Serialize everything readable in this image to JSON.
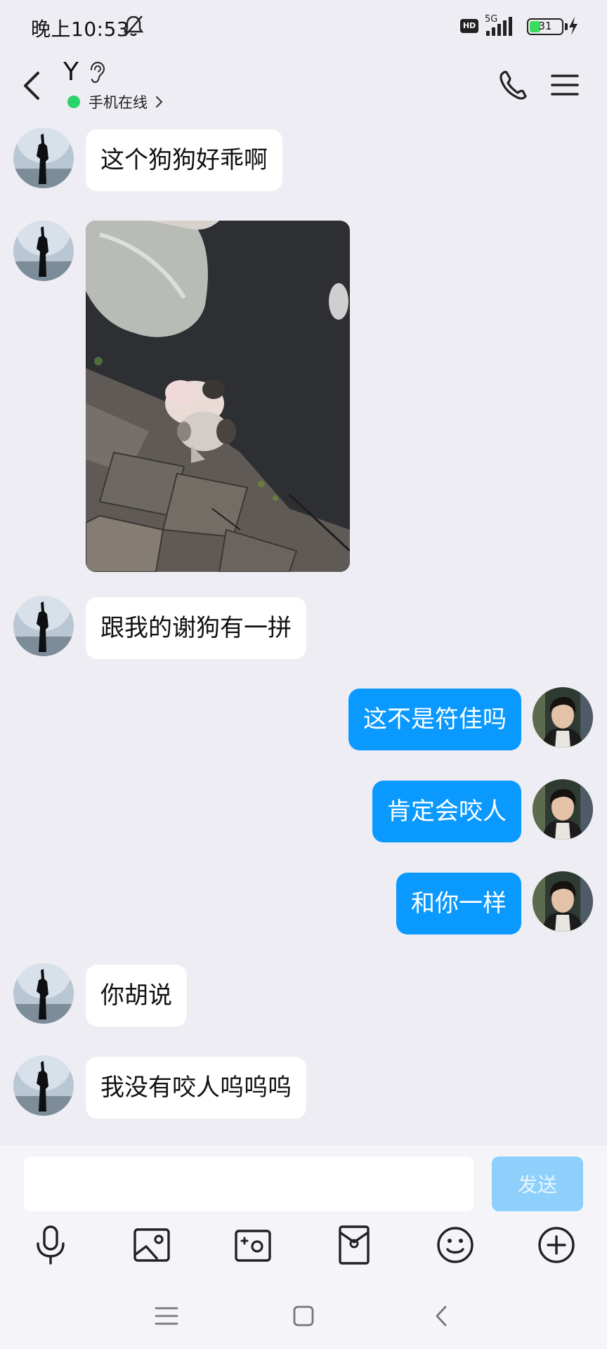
{
  "status_bar": {
    "time": "晚上10:53",
    "hd_label": "HD",
    "network_label": "5G",
    "battery_level": "31",
    "battery_fraction": 0.31
  },
  "header": {
    "contact_name": "Y",
    "online_status": "手机在线",
    "icons": [
      "back-icon",
      "ear-icon",
      "chevron-right-icon",
      "phone-icon",
      "menu-icon"
    ]
  },
  "messages": [
    {
      "side": "left",
      "type": "text",
      "text": "这个狗狗好乖啊"
    },
    {
      "side": "left",
      "type": "image"
    },
    {
      "side": "left",
      "type": "text",
      "text": "跟我的谢狗有一拼"
    },
    {
      "side": "right",
      "type": "text",
      "text": "这不是符佳吗"
    },
    {
      "side": "right",
      "type": "text",
      "text": "肯定会咬人"
    },
    {
      "side": "right",
      "type": "text",
      "text": "和你一样"
    },
    {
      "side": "left",
      "type": "text",
      "text": "你胡说"
    },
    {
      "side": "left",
      "type": "text",
      "text": "我没有咬人呜呜呜"
    }
  ],
  "input": {
    "value": "",
    "send_label": "发送"
  },
  "toolbar": [
    "microphone-icon",
    "image-icon",
    "camera-icon",
    "red-packet-icon",
    "emoji-icon",
    "plus-icon"
  ],
  "nav_bar": [
    "menu-nav-icon",
    "home-nav-icon",
    "back-nav-icon"
  ],
  "colors": {
    "background": "#EDEDF3",
    "bubble_sent": "#0A99FF",
    "bubble_received": "#FFFFFF",
    "send_button": "#8ED0FB",
    "online": "#2BD469"
  }
}
